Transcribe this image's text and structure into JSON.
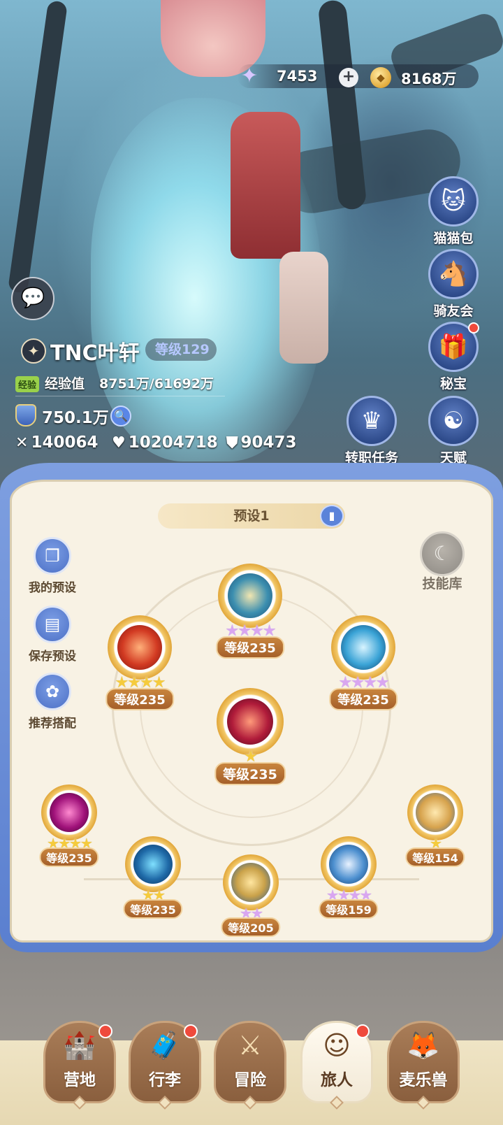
{
  "currency": {
    "stamina_value": "7453",
    "plus_label": "+",
    "gold_value": "8168万",
    "stamina_icon": "star-icon",
    "gold_icon": "coin-icon"
  },
  "side_menu": [
    {
      "label": "猫猫包",
      "icon": "cat-bag-icon",
      "glyph": "🐱",
      "badge": false
    },
    {
      "label": "骑友会",
      "icon": "horse-icon",
      "glyph": "🐴",
      "badge": false
    },
    {
      "label": "秘宝",
      "icon": "treasure-icon",
      "glyph": "🎁",
      "badge": true
    },
    {
      "label": "天赋",
      "icon": "talent-head-icon",
      "glyph": "☯",
      "badge": false
    },
    {
      "label": "转职任务",
      "icon": "job-change-icon",
      "glyph": "♛",
      "badge": false
    }
  ],
  "player": {
    "name": "TNC叶轩",
    "level": "等级129",
    "exp_tag": "经验",
    "exp_label": "经验值",
    "exp_value": "8751万/61692万",
    "power": "750.1万",
    "attack": "140064",
    "hp": "10204718",
    "defense": "90473"
  },
  "panel": {
    "preset_title": "预设1",
    "left_options": [
      {
        "label": "我的预设",
        "icon": "my-preset-icon",
        "glyph": "❐"
      },
      {
        "label": "保存预设",
        "icon": "save-icon",
        "glyph": "▤"
      },
      {
        "label": "推荐搭配",
        "icon": "recommend-icon",
        "glyph": "✿"
      }
    ],
    "skill_library": "技能库"
  },
  "skills": [
    {
      "level": "等级235",
      "stars": 4,
      "star_color": "purple",
      "name_icon": "holy-seal-skill-icon"
    },
    {
      "level": "等级235",
      "stars": 4,
      "star_color": "gold",
      "name_icon": "fire-claw-skill-icon"
    },
    {
      "level": "等级235",
      "stars": 4,
      "star_color": "purple",
      "name_icon": "wind-dash-skill-icon"
    },
    {
      "level": "等级235",
      "stars": 1,
      "star_color": "gold",
      "name_icon": "crimson-spear-skill-icon"
    },
    {
      "level": "等级235",
      "stars": 4,
      "star_color": "gold",
      "name_icon": "dark-flame-skill-icon"
    },
    {
      "level": "等级235",
      "stars": 2,
      "star_color": "gold",
      "name_icon": "shadow-spirit-skill-icon"
    },
    {
      "level": "等级205",
      "stars": 2,
      "star_color": "purple",
      "name_icon": "golden-fortress-skill-icon"
    },
    {
      "level": "等级159",
      "stars": 4,
      "star_color": "purple",
      "name_icon": "blade-rush-skill-icon"
    },
    {
      "level": "等级154",
      "stars": 1,
      "star_color": "gold",
      "name_icon": "lion-roar-skill-icon"
    }
  ],
  "bottom_nav": [
    {
      "label": "营地",
      "icon": "castle-icon",
      "glyph": "🏰",
      "badge": true,
      "active": false
    },
    {
      "label": "行李",
      "icon": "luggage-icon",
      "glyph": "🧳",
      "badge": true,
      "active": false
    },
    {
      "label": "冒险",
      "icon": "crossed-swords-icon",
      "glyph": "⚔",
      "badge": false,
      "active": false
    },
    {
      "label": "旅人",
      "icon": "traveler-icon",
      "glyph": "☺",
      "badge": true,
      "active": true
    },
    {
      "label": "麦乐兽",
      "icon": "pet-fox-icon",
      "glyph": "🦊",
      "badge": false,
      "active": false
    }
  ],
  "colors": {
    "panel_frame": "#5a7fcf",
    "panel_bg": "#f8f2e4",
    "level_tag": "#a5602a",
    "badge_red": "#ef4a3c"
  }
}
